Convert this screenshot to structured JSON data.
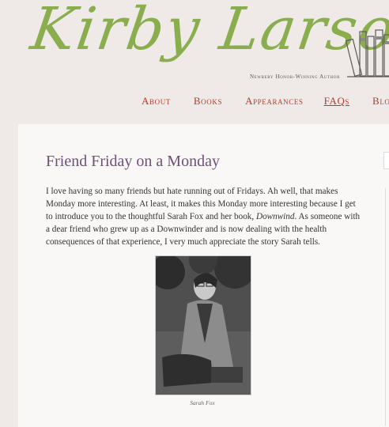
{
  "header": {
    "logo_text": "Kirby Larson",
    "tagline": "Newbery Honor-Winning Author"
  },
  "nav": {
    "about": "About",
    "books": "Books",
    "appearances": "Appearances",
    "faqs": "FAQs",
    "blog": "Blog"
  },
  "post": {
    "title": "Friend Friday on a Monday",
    "body_part1": "I love having so many friends but hate running out of Fridays. Ah well, that makes Monday more interesting. At least, it makes this Monday more interesting because I get to introduce you to the thoughtful Sarah Fox and her book, ",
    "book_title": "Downwind",
    "body_part2": ". As someone with a dear friend who grew up as a Downwinder and is now dealing with the health consequences of that experience, I very much appreciate the story Sarah tells.",
    "photo_caption": "Sarah Fox"
  },
  "colors": {
    "logo_green": "#8aae4e",
    "nav_red": "#b73a2c",
    "title_purple": "#6e4f78"
  }
}
